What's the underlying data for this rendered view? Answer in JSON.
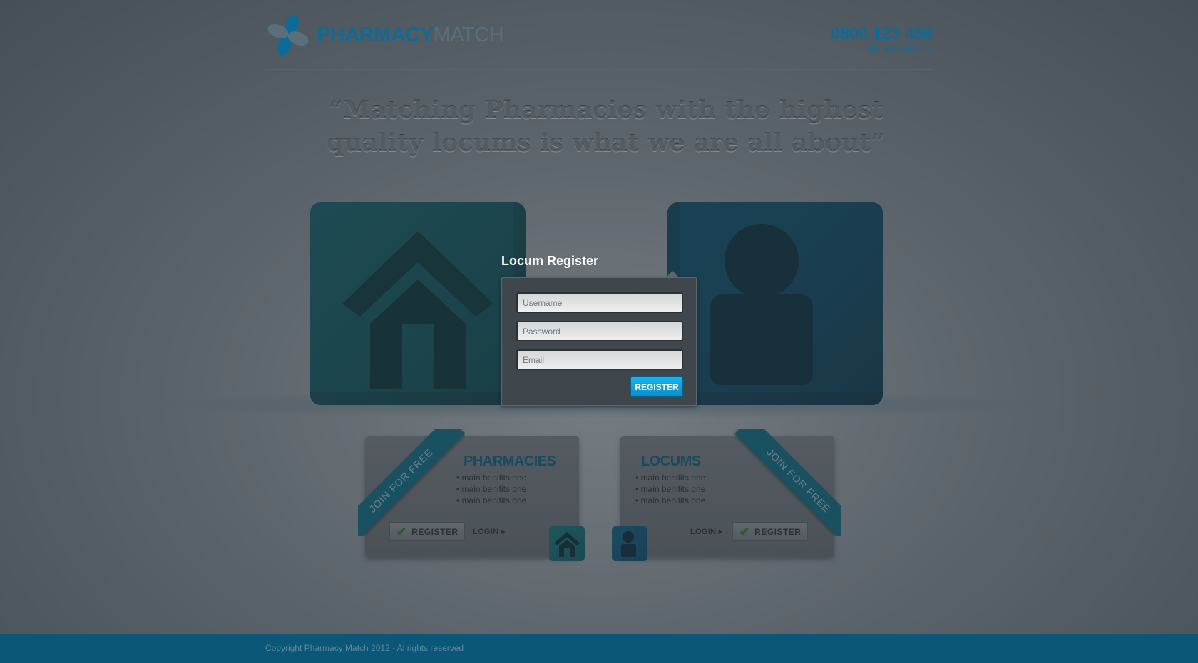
{
  "header": {
    "logo_strong": "PHARMACY",
    "logo_light": "MATCH",
    "logo_icon": "flower-icon",
    "phone": "0800 123 456",
    "login_link": "LOGIN/REGISTER"
  },
  "tagline": "“Matching Pharmacies with the highest quality locums is what we are all about”",
  "register": {
    "title": "Locum Register",
    "username_placeholder": "Username",
    "password_placeholder": "Password",
    "email_placeholder": "Email",
    "button": "REGISTER"
  },
  "cards": {
    "pharmacies": {
      "ribbon": "JOIN FOR FREE",
      "title": "PHARMACIES",
      "items": [
        "• main benifits one",
        "• main benifits one",
        "• main benifits one"
      ],
      "register": "REGISTER",
      "login": "LOGIN ▸"
    },
    "locums": {
      "ribbon": "JOIN FOR FREE",
      "title": "LOCUMS",
      "items": [
        "• main benifits one",
        "• main benifits one",
        "• main benifits one"
      ],
      "register": "REGISTER",
      "login": "LOGIN ▸"
    }
  },
  "footer": {
    "copyright": "Copyright Pharmacy Match 2012 - Al rights reserved"
  },
  "colors": {
    "brand_blue": "#0d6c97",
    "accent_cyan": "#16b6ee",
    "footer": "#0a5777"
  }
}
